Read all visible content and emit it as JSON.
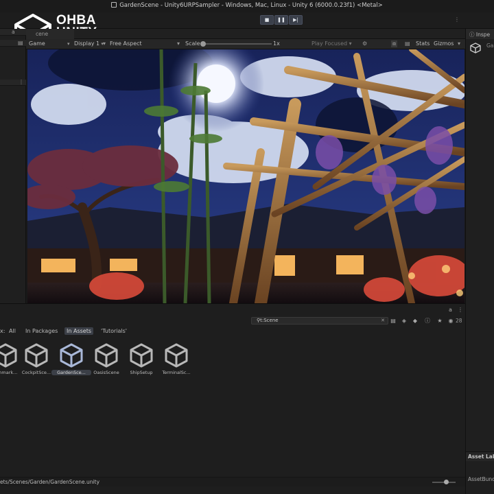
{
  "window": {
    "title": "GardenScene - Unity6URPSampler - Windows, Mac, Linux - Unity 6 (6000.0.23f1) <Metal>"
  },
  "logo": {
    "line1": "OHBA",
    "line2": "UNITY"
  },
  "toolbar": {
    "play_icon": "stop-square-icon",
    "pause_icon": "pause-icon",
    "step_icon": "step-forward-icon",
    "more": "⋮"
  },
  "hierarchy": {
    "tab_label": "a",
    "more": "⋮"
  },
  "game_view": {
    "tab_label": "cene",
    "display_mode": "Game",
    "display": "Display 1",
    "aspect": "Free Aspect",
    "scale_label": "Scale",
    "scale_value": "1x",
    "play_mode": "Play Focused",
    "stats": "Stats",
    "gizmos": "Gizmos"
  },
  "inspector": {
    "tab_label": "Inspe",
    "object_name": "Ga",
    "asset_labels": "Asset Lab",
    "asset_bundle": "AssetBund"
  },
  "project": {
    "search_value": "t:Scene",
    "item_count": "28",
    "filters": [
      "x:",
      "All",
      "In Packages",
      "In Assets",
      "'Tutorials'"
    ],
    "selected_filter": "In Assets",
    "assets": [
      {
        "label": "nchmark..."
      },
      {
        "label": "CockpitSce..."
      },
      {
        "label": "GardenSce...",
        "selected": true
      },
      {
        "label": "OasisScene"
      },
      {
        "label": "ShipSetup"
      },
      {
        "label": "TerminalSc..."
      }
    ],
    "path": "ets/Scenes/Garden/GardenScene.unity"
  },
  "colors": {
    "accent_selected": "#3b3f47",
    "background": "#1e1e1e",
    "sky_night": "#1d2c63"
  }
}
